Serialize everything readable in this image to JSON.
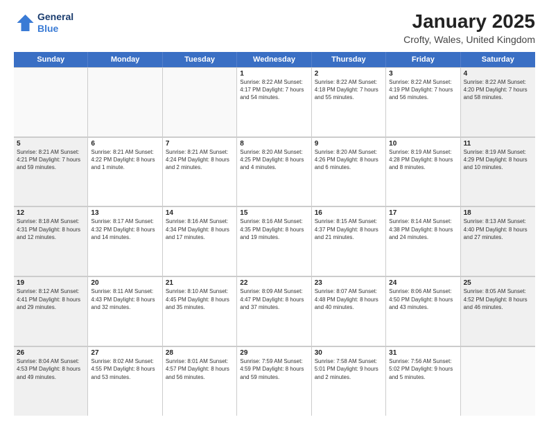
{
  "logo": {
    "line1": "General",
    "line2": "Blue"
  },
  "header": {
    "title": "January 2025",
    "subtitle": "Crofty, Wales, United Kingdom"
  },
  "days_of_week": [
    "Sunday",
    "Monday",
    "Tuesday",
    "Wednesday",
    "Thursday",
    "Friday",
    "Saturday"
  ],
  "weeks": [
    [
      {
        "day": "",
        "info": "",
        "empty": true
      },
      {
        "day": "",
        "info": "",
        "empty": true
      },
      {
        "day": "",
        "info": "",
        "empty": true
      },
      {
        "day": "1",
        "info": "Sunrise: 8:22 AM\nSunset: 4:17 PM\nDaylight: 7 hours\nand 54 minutes.",
        "empty": false
      },
      {
        "day": "2",
        "info": "Sunrise: 8:22 AM\nSunset: 4:18 PM\nDaylight: 7 hours\nand 55 minutes.",
        "empty": false
      },
      {
        "day": "3",
        "info": "Sunrise: 8:22 AM\nSunset: 4:19 PM\nDaylight: 7 hours\nand 56 minutes.",
        "empty": false
      },
      {
        "day": "4",
        "info": "Sunrise: 8:22 AM\nSunset: 4:20 PM\nDaylight: 7 hours\nand 58 minutes.",
        "empty": false,
        "shaded": true
      }
    ],
    [
      {
        "day": "5",
        "info": "Sunrise: 8:21 AM\nSunset: 4:21 PM\nDaylight: 7 hours\nand 59 minutes.",
        "empty": false,
        "shaded": true
      },
      {
        "day": "6",
        "info": "Sunrise: 8:21 AM\nSunset: 4:22 PM\nDaylight: 8 hours\nand 1 minute.",
        "empty": false
      },
      {
        "day": "7",
        "info": "Sunrise: 8:21 AM\nSunset: 4:24 PM\nDaylight: 8 hours\nand 2 minutes.",
        "empty": false
      },
      {
        "day": "8",
        "info": "Sunrise: 8:20 AM\nSunset: 4:25 PM\nDaylight: 8 hours\nand 4 minutes.",
        "empty": false
      },
      {
        "day": "9",
        "info": "Sunrise: 8:20 AM\nSunset: 4:26 PM\nDaylight: 8 hours\nand 6 minutes.",
        "empty": false
      },
      {
        "day": "10",
        "info": "Sunrise: 8:19 AM\nSunset: 4:28 PM\nDaylight: 8 hours\nand 8 minutes.",
        "empty": false
      },
      {
        "day": "11",
        "info": "Sunrise: 8:19 AM\nSunset: 4:29 PM\nDaylight: 8 hours\nand 10 minutes.",
        "empty": false,
        "shaded": true
      }
    ],
    [
      {
        "day": "12",
        "info": "Sunrise: 8:18 AM\nSunset: 4:31 PM\nDaylight: 8 hours\nand 12 minutes.",
        "empty": false,
        "shaded": true
      },
      {
        "day": "13",
        "info": "Sunrise: 8:17 AM\nSunset: 4:32 PM\nDaylight: 8 hours\nand 14 minutes.",
        "empty": false
      },
      {
        "day": "14",
        "info": "Sunrise: 8:16 AM\nSunset: 4:34 PM\nDaylight: 8 hours\nand 17 minutes.",
        "empty": false
      },
      {
        "day": "15",
        "info": "Sunrise: 8:16 AM\nSunset: 4:35 PM\nDaylight: 8 hours\nand 19 minutes.",
        "empty": false
      },
      {
        "day": "16",
        "info": "Sunrise: 8:15 AM\nSunset: 4:37 PM\nDaylight: 8 hours\nand 21 minutes.",
        "empty": false
      },
      {
        "day": "17",
        "info": "Sunrise: 8:14 AM\nSunset: 4:38 PM\nDaylight: 8 hours\nand 24 minutes.",
        "empty": false
      },
      {
        "day": "18",
        "info": "Sunrise: 8:13 AM\nSunset: 4:40 PM\nDaylight: 8 hours\nand 27 minutes.",
        "empty": false,
        "shaded": true
      }
    ],
    [
      {
        "day": "19",
        "info": "Sunrise: 8:12 AM\nSunset: 4:41 PM\nDaylight: 8 hours\nand 29 minutes.",
        "empty": false,
        "shaded": true
      },
      {
        "day": "20",
        "info": "Sunrise: 8:11 AM\nSunset: 4:43 PM\nDaylight: 8 hours\nand 32 minutes.",
        "empty": false
      },
      {
        "day": "21",
        "info": "Sunrise: 8:10 AM\nSunset: 4:45 PM\nDaylight: 8 hours\nand 35 minutes.",
        "empty": false
      },
      {
        "day": "22",
        "info": "Sunrise: 8:09 AM\nSunset: 4:47 PM\nDaylight: 8 hours\nand 37 minutes.",
        "empty": false
      },
      {
        "day": "23",
        "info": "Sunrise: 8:07 AM\nSunset: 4:48 PM\nDaylight: 8 hours\nand 40 minutes.",
        "empty": false
      },
      {
        "day": "24",
        "info": "Sunrise: 8:06 AM\nSunset: 4:50 PM\nDaylight: 8 hours\nand 43 minutes.",
        "empty": false
      },
      {
        "day": "25",
        "info": "Sunrise: 8:05 AM\nSunset: 4:52 PM\nDaylight: 8 hours\nand 46 minutes.",
        "empty": false,
        "shaded": true
      }
    ],
    [
      {
        "day": "26",
        "info": "Sunrise: 8:04 AM\nSunset: 4:53 PM\nDaylight: 8 hours\nand 49 minutes.",
        "empty": false,
        "shaded": true
      },
      {
        "day": "27",
        "info": "Sunrise: 8:02 AM\nSunset: 4:55 PM\nDaylight: 8 hours\nand 53 minutes.",
        "empty": false
      },
      {
        "day": "28",
        "info": "Sunrise: 8:01 AM\nSunset: 4:57 PM\nDaylight: 8 hours\nand 56 minutes.",
        "empty": false
      },
      {
        "day": "29",
        "info": "Sunrise: 7:59 AM\nSunset: 4:59 PM\nDaylight: 8 hours\nand 59 minutes.",
        "empty": false
      },
      {
        "day": "30",
        "info": "Sunrise: 7:58 AM\nSunset: 5:01 PM\nDaylight: 9 hours\nand 2 minutes.",
        "empty": false
      },
      {
        "day": "31",
        "info": "Sunrise: 7:56 AM\nSunset: 5:02 PM\nDaylight: 9 hours\nand 5 minutes.",
        "empty": false
      },
      {
        "day": "",
        "info": "",
        "empty": true,
        "shaded": true
      }
    ]
  ]
}
